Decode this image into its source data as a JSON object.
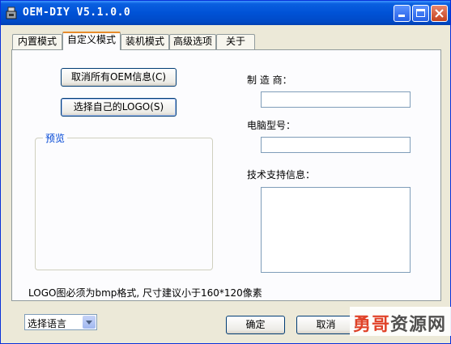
{
  "window": {
    "title": "OEM-DIY V5.1.0.0"
  },
  "tabs": [
    {
      "label": "内置模式",
      "active": false
    },
    {
      "label": "自定义模式",
      "active": true
    },
    {
      "label": "装机模式",
      "active": false
    },
    {
      "label": "高级选项",
      "active": false
    },
    {
      "label": "关于",
      "active": false
    }
  ],
  "custom": {
    "cancel_oem_button": "取消所有OEM信息(C)",
    "choose_logo_button": "选择自己的LOGO(S)",
    "preview_label": "预览",
    "manufacturer_label": "制 造 商：",
    "manufacturer_value": "",
    "model_label": "电脑型号：",
    "model_value": "",
    "support_label": "技术支持信息：",
    "support_value": "",
    "logo_note": "LOGO图必须为bmp格式, 尺寸建议小于160*120像素"
  },
  "footer": {
    "language_select": "选择语言",
    "ok_button": "确定",
    "cancel_button": "取消"
  },
  "watermark": {
    "part1": "勇哥",
    "part2": "资源网"
  },
  "colors": {
    "titlebar": "#0052d6",
    "accent_tab": "#e68b2c",
    "close_button": "#c4421e"
  }
}
